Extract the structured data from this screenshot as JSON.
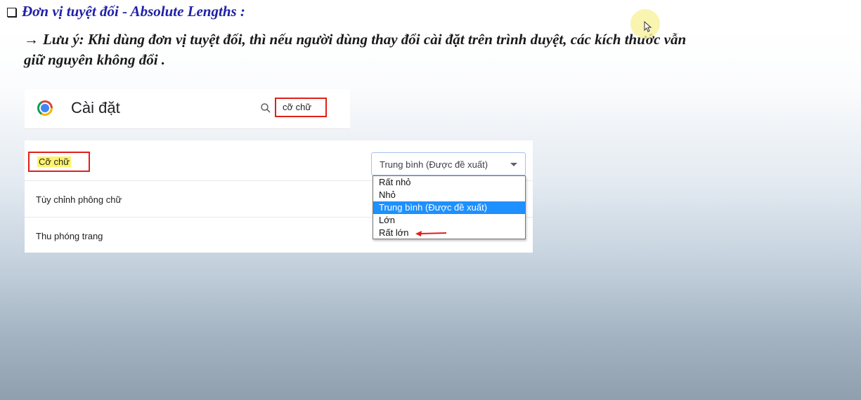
{
  "heading": {
    "text": "Đơn vị tuyệt đối - Absolute Lengths :",
    "icon": "checkbox-icon"
  },
  "note": {
    "arrow": "→",
    "line1": "Lưu ý: Khi dùng đơn vị tuyệt đối, thì nếu người dùng thay đổi cài đặt trên trình duyệt, các kích thước vẫn",
    "line2": "giữ nguyên không đổi ."
  },
  "settings_header": {
    "title": "Cài đặt",
    "search_value": "cỡ chữ",
    "logo": "chrome-logo",
    "search_icon": "search-icon"
  },
  "settings": {
    "rows": [
      {
        "label": "Cỡ chữ"
      },
      {
        "label": "Tùy chỉnh phông chữ"
      },
      {
        "label": "Thu phóng trang"
      }
    ],
    "font_size_select": {
      "value": "Trung bình (Được đề xuất)",
      "options": [
        "Rất nhỏ",
        "Nhỏ",
        "Trung bình (Được đề xuất)",
        "Lớn",
        "Rất lớn"
      ],
      "selected_index": 2
    }
  },
  "colors": {
    "heading_blue": "#1f1fa8",
    "highlight_red": "#e0201a",
    "option_selected": "#1e90ff",
    "label_highlight": "#fff36b"
  }
}
